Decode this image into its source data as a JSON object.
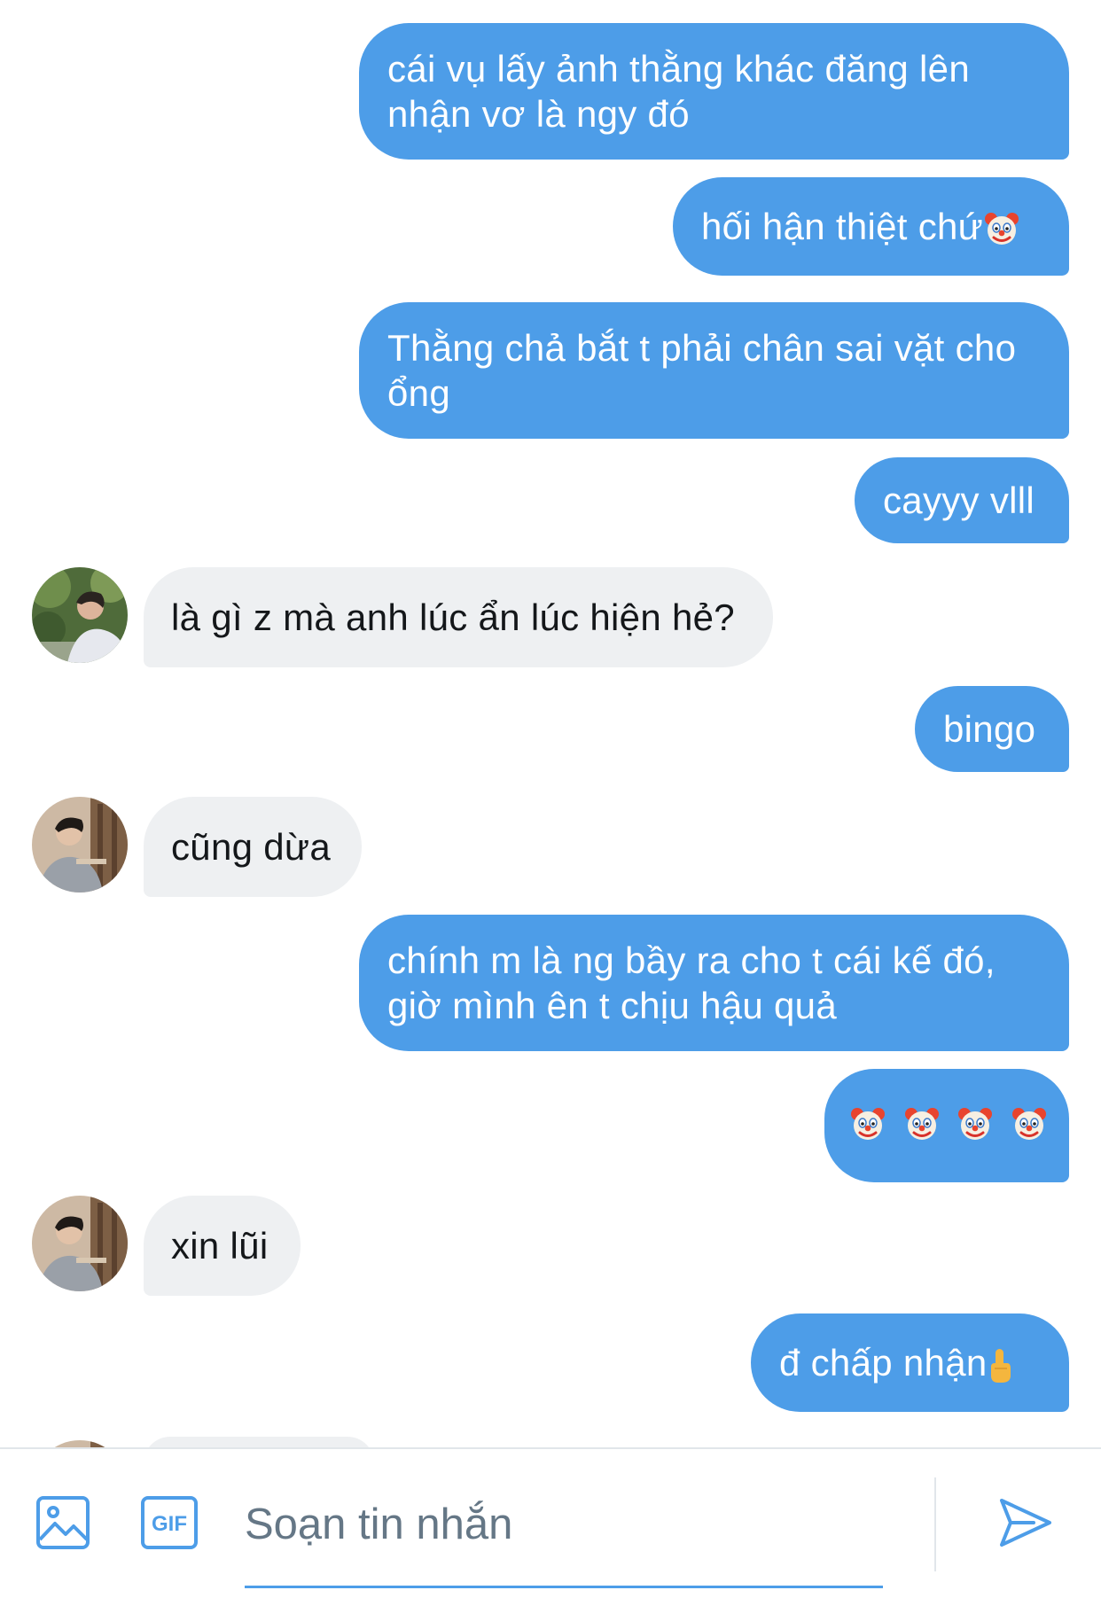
{
  "colors": {
    "outgoing_bubble": "#4d9de8",
    "incoming_bubble": "#eef0f2",
    "accent": "#4d9de8",
    "placeholder": "#657786"
  },
  "messages": [
    {
      "direction": "out",
      "lines": [
        "cái vụ lấy ảnh thằng khác đăng lên",
        "nhận vơ là ngy đó"
      ]
    },
    {
      "direction": "out",
      "text": "hối hận thiệt chứ",
      "emoji": "clown-face"
    },
    {
      "direction": "out",
      "lines": [
        "Thằng chả bắt t phải chân sai vặt cho",
        "ổng"
      ]
    },
    {
      "direction": "out",
      "text": "cayyy vlll"
    },
    {
      "direction": "in",
      "text": "là gì z mà anh lúc ẩn lúc hiện hẻ?"
    },
    {
      "direction": "out",
      "text": "bingo"
    },
    {
      "direction": "in",
      "text": "cũng dừa"
    },
    {
      "direction": "out",
      "lines": [
        "chính m là ng bầy ra cho t cái kế đó,",
        "giờ mình ên t chịu hậu quả"
      ]
    },
    {
      "direction": "out",
      "emoji_row": [
        "clown-face",
        "clown-face",
        "clown-face",
        "clown-face"
      ]
    },
    {
      "direction": "in",
      "text": "xin lũi"
    },
    {
      "direction": "out",
      "text": "đ chấp nhận",
      "emoji": "middle-finger"
    }
  ],
  "composer": {
    "placeholder": "Soạn tin nhắn",
    "gif_label": "GIF",
    "image_icon": "image-icon",
    "gif_icon": "gif-icon",
    "send_icon": "send-icon"
  }
}
